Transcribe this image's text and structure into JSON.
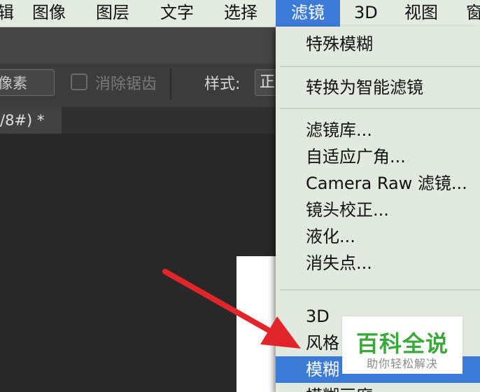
{
  "menubar": {
    "items": [
      {
        "label": "辑",
        "active": false
      },
      {
        "label": "图像",
        "active": false
      },
      {
        "label": "图层",
        "active": false
      },
      {
        "label": "文字",
        "active": false
      },
      {
        "label": "选择",
        "active": false
      },
      {
        "label": "滤镜",
        "active": true
      },
      {
        "label": "3D",
        "active": false
      },
      {
        "label": "视图",
        "active": false
      },
      {
        "label": "窗",
        "active": false
      }
    ]
  },
  "options_bar": {
    "pixels_value": "像素",
    "antialias_label": "消除锯齿",
    "antialias_checked": false,
    "style_label": "样式:",
    "style_value": "正"
  },
  "document_tab": {
    "label": "/8#) *"
  },
  "filter_menu": {
    "items": [
      {
        "label": "特殊模糊",
        "active": false
      },
      {
        "label": "转换为智能滤镜",
        "active": false
      },
      {
        "label": "滤镜库...",
        "active": false
      },
      {
        "label": "自适应广角...",
        "active": false
      },
      {
        "label": "Camera Raw 滤镜...",
        "active": false
      },
      {
        "label": "镜头校正...",
        "active": false
      },
      {
        "label": "液化...",
        "active": false
      },
      {
        "label": "消失点...",
        "active": false
      },
      {
        "label": "3D",
        "active": false
      },
      {
        "label": "风格",
        "active": false
      },
      {
        "label": "模糊",
        "active": true
      },
      {
        "label": "模糊画廊",
        "active": false
      }
    ]
  },
  "watermark": {
    "title": "百科全说",
    "subtitle": "助你轻松解决"
  },
  "colors": {
    "menu_highlight": "#3c7bd8",
    "annotation_arrow": "#e0262b",
    "watermark_green": "#3aa83a"
  },
  "icons": [
    "checkbox-icon",
    "annotation-arrow-icon"
  ]
}
